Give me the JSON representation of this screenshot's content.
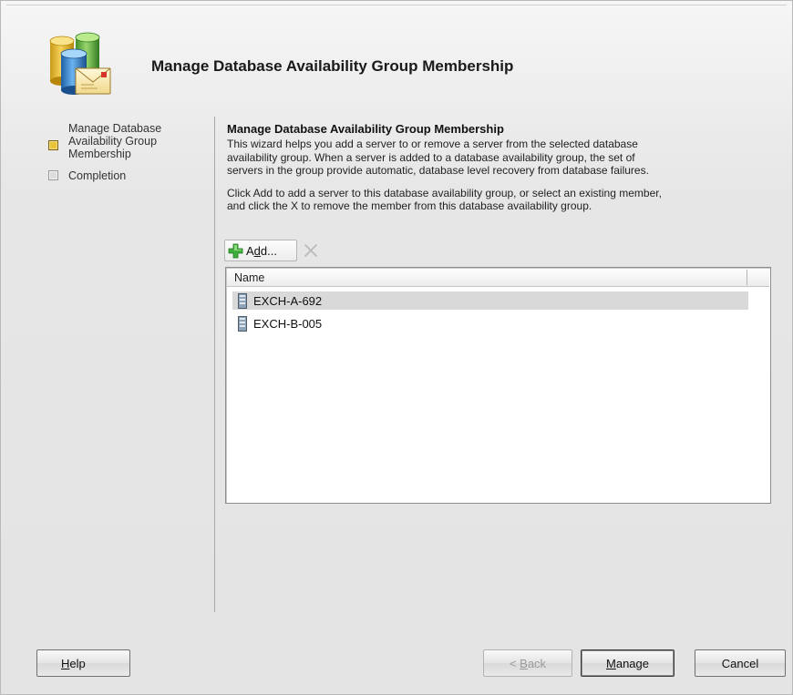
{
  "window": {
    "title": "Manage Database Availability Group Membership"
  },
  "steps": [
    {
      "label_lines": [
        "Manage Database",
        "Availability Group",
        "Membership"
      ],
      "state": "current"
    },
    {
      "label_lines": [
        "Completion"
      ],
      "state": "pending"
    }
  ],
  "content": {
    "title": "Manage Database Availability Group Membership",
    "description_lines": [
      "This wizard helps you add a server to or remove a server from the selected database",
      "availability group. When a server is added to a database availability group, the set of",
      "servers in the group provide automatic, database level recovery from database failures."
    ],
    "instruction_lines": [
      "Click Add to add a server to this database availability group, or select an existing member,",
      "and click the X to remove the member from this database availability group."
    ]
  },
  "toolbar": {
    "add_prefix": "A",
    "add_mnemonic": "d",
    "add_suffix": "d...",
    "add_icon": "green-plus-icon",
    "remove_icon": "remove-x-icon"
  },
  "list": {
    "column": "Name",
    "rows": [
      {
        "name": "EXCH-A-692",
        "selected": true
      },
      {
        "name": "EXCH-B-005",
        "selected": false
      }
    ]
  },
  "buttons": {
    "help_mnemonic": "H",
    "help_rest": "elp",
    "back_prefix": "< ",
    "back_mnemonic": "B",
    "back_rest": "ack",
    "manage_mnemonic": "M",
    "manage_rest": "anage",
    "cancel": "Cancel"
  },
  "colors": {
    "step_current": "#e8c43a",
    "step_pending": "#dcdcdc",
    "selection": "#d9d9d9",
    "add_icon": "#3fae3f"
  }
}
